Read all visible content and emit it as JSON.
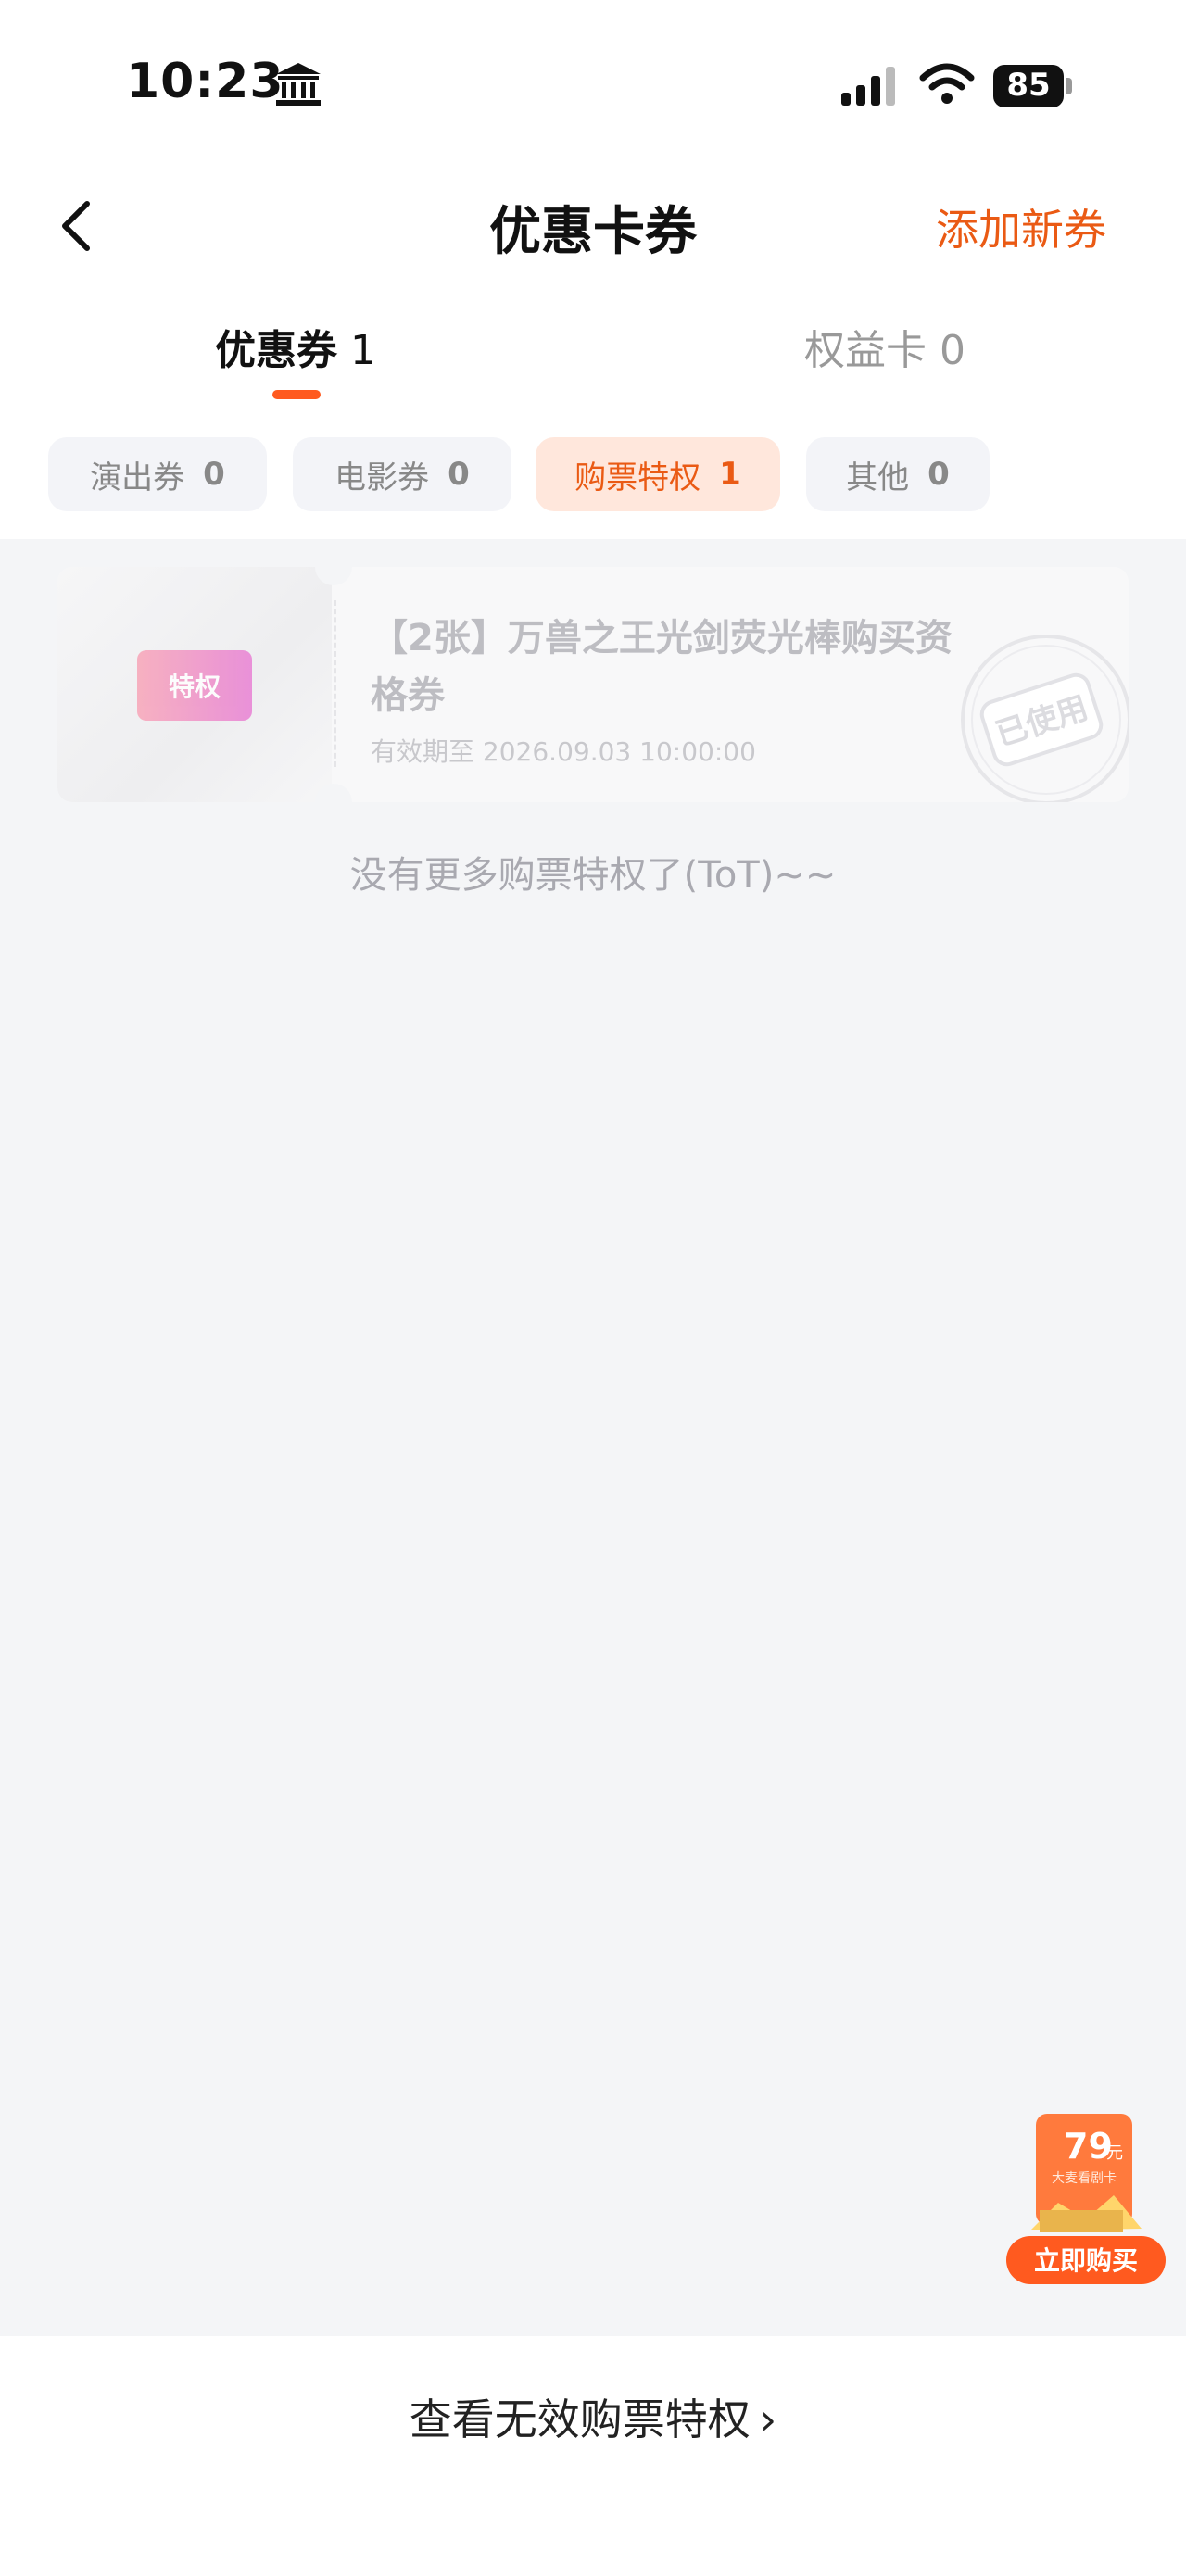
{
  "status_bar": {
    "time": "10:23",
    "battery": "85"
  },
  "nav": {
    "title": "优惠卡券",
    "add_button": "添加新券"
  },
  "main_tabs": [
    {
      "label": "优惠券",
      "count": "1",
      "active": true
    },
    {
      "label": "权益卡",
      "count": "0",
      "active": false
    }
  ],
  "chips": [
    {
      "label": "演出券",
      "count": "0"
    },
    {
      "label": "电影券",
      "count": "0"
    },
    {
      "label": "购票特权",
      "count": "1",
      "active": true
    },
    {
      "label": "其他",
      "count": "0"
    }
  ],
  "voucher": {
    "badge": "特权",
    "title": "【2张】万兽之王光剑荧光棒购买资格券",
    "expiry_label": "有效期至",
    "expiry_value": "2026.09.03 10:00:00",
    "stamp": "已使用"
  },
  "no_more_text": "没有更多购票特权了(ToT)~~",
  "promo": {
    "price": "79",
    "unit": "元",
    "card_name": "大麦看剧卡",
    "buy_label": "立即购买"
  },
  "bottom": {
    "view_invalid": "查看无效购票特权",
    "chevron": "›"
  },
  "colors": {
    "accent": "#ea5a14",
    "tab_indicator": "#ff5a1f",
    "active_chip_bg": "#ffe7dc"
  },
  "icons": {
    "status": [
      "bank-icon",
      "signal-icon",
      "wifi-icon",
      "battery-icon"
    ],
    "nav": [
      "back-arrow-icon"
    ]
  }
}
